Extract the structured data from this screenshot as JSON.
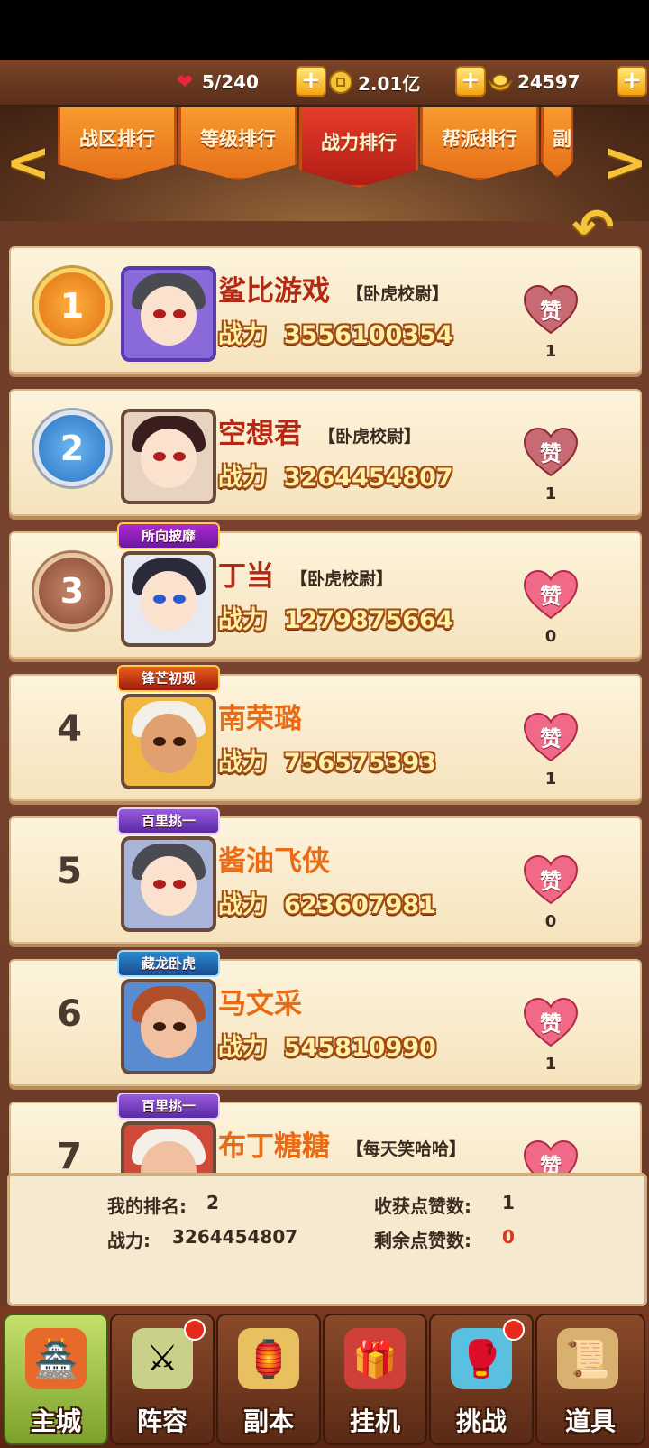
{
  "resources": {
    "stamina": "5/240",
    "coins": "2.01亿",
    "gold": "24597",
    "plus": "+"
  },
  "tabs": [
    "战区排行",
    "等级排行",
    "战力排行",
    "帮派排行",
    "副"
  ],
  "nav_arrows": {
    "left": "<",
    "right": ">"
  },
  "back_icon": "↶",
  "heart_label": "赞",
  "power_label": "战力",
  "rankings": [
    {
      "rank": "1",
      "name": "鲨比游戏",
      "title": "【卧虎校尉】",
      "power": "3556100354",
      "likes": "1"
    },
    {
      "rank": "2",
      "name": "空想君",
      "title": "【卧虎校尉】",
      "power": "3264454807",
      "likes": "1"
    },
    {
      "rank": "3",
      "name": "丁当",
      "title": "【卧虎校尉】",
      "power": "1279875664",
      "likes": "0",
      "badge": "所向披靡"
    },
    {
      "rank": "4",
      "name": "南荣璐",
      "title": "",
      "power": "756575393",
      "likes": "1",
      "badge": "锋芒初现"
    },
    {
      "rank": "5",
      "name": "酱油飞侠",
      "title": "",
      "power": "623607981",
      "likes": "0",
      "badge": "百里挑一"
    },
    {
      "rank": "6",
      "name": "马文采",
      "title": "",
      "power": "545810990",
      "likes": "1",
      "badge": "藏龙卧虎"
    },
    {
      "rank": "7",
      "name": "布丁糖糖",
      "title": "【每天笑哈哈】",
      "power": "",
      "likes": "",
      "badge": "百里挑一"
    }
  ],
  "my_info": {
    "rank_label": "我的排名:",
    "rank_value": "2",
    "power_label": "战力:",
    "power_value": "3264454807",
    "received_label": "收获点赞数:",
    "received_value": "1",
    "remaining_label": "剩余点赞数:",
    "remaining_value": "0"
  },
  "bottom_nav": [
    "主城",
    "阵容",
    "副本",
    "挂机",
    "挑战",
    "道具"
  ],
  "colors": {
    "accent": "#e96b14",
    "active_tab": "#c0241a",
    "heart": "#f06a88"
  }
}
